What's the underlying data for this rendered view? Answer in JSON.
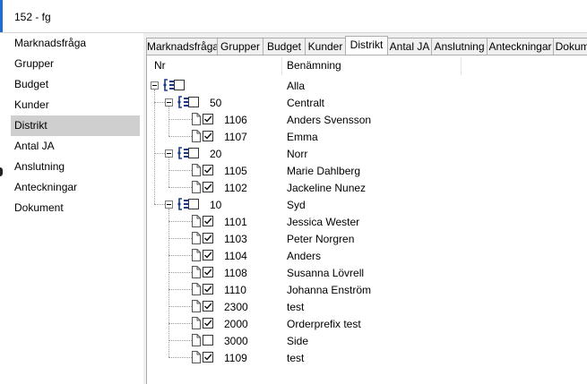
{
  "window": {
    "title": "152 - fg"
  },
  "sidebar": {
    "items": [
      {
        "label": "Marknadsfråga"
      },
      {
        "label": "Grupper"
      },
      {
        "label": "Budget"
      },
      {
        "label": "Kunder"
      },
      {
        "label": "Distrikt"
      },
      {
        "label": "Antal JA"
      },
      {
        "label": "Anslutning"
      },
      {
        "label": "Anteckningar"
      },
      {
        "label": "Dokument"
      }
    ],
    "selected": "Distrikt"
  },
  "tabs": [
    {
      "label": "Marknadsfråga"
    },
    {
      "label": "Grupper"
    },
    {
      "label": "Budget"
    },
    {
      "label": "Kunder"
    },
    {
      "label": "Distrikt",
      "active": true
    },
    {
      "label": "Antal JA"
    },
    {
      "label": "Anslutning"
    },
    {
      "label": "Anteckningar"
    },
    {
      "label": "Dokument"
    }
  ],
  "grid": {
    "columns": {
      "nr": "Nr",
      "name": "Benämning"
    }
  },
  "tree": [
    {
      "level": 0,
      "type": "folder",
      "nr": "",
      "name": "Alla",
      "checked": false
    },
    {
      "level": 1,
      "type": "folder",
      "nr": "50",
      "name": "Centralt",
      "checked": false
    },
    {
      "level": 2,
      "type": "item",
      "nr": "1106",
      "name": "Anders Svensson",
      "checked": true
    },
    {
      "level": 2,
      "type": "item",
      "nr": "1107",
      "name": "Emma",
      "checked": true
    },
    {
      "level": 1,
      "type": "folder",
      "nr": "20",
      "name": "Norr",
      "checked": false
    },
    {
      "level": 2,
      "type": "item",
      "nr": "1105",
      "name": "Marie Dahlberg",
      "checked": true
    },
    {
      "level": 2,
      "type": "item",
      "nr": "1102",
      "name": "Jackeline Nunez",
      "checked": true
    },
    {
      "level": 1,
      "type": "folder",
      "nr": "10",
      "name": "Syd",
      "checked": false
    },
    {
      "level": 2,
      "type": "item",
      "nr": "1101",
      "name": "Jessica Wester",
      "checked": true
    },
    {
      "level": 2,
      "type": "item",
      "nr": "1103",
      "name": "Peter Norgren",
      "checked": true
    },
    {
      "level": 2,
      "type": "item",
      "nr": "1104",
      "name": "Anders",
      "checked": true
    },
    {
      "level": 2,
      "type": "item",
      "nr": "1108",
      "name": "Susanna Lövrell",
      "checked": true
    },
    {
      "level": 2,
      "type": "item",
      "nr": "1110",
      "name": "Johanna Enström",
      "checked": true
    },
    {
      "level": 2,
      "type": "item",
      "nr": "2300",
      "name": "test",
      "checked": true
    },
    {
      "level": 2,
      "type": "item",
      "nr": "2000",
      "name": "Orderprefix test",
      "checked": true
    },
    {
      "level": 2,
      "type": "item",
      "nr": "3000",
      "name": "Side",
      "checked": false
    },
    {
      "level": 2,
      "type": "item",
      "nr": "1109",
      "name": "test",
      "checked": true
    }
  ],
  "icons": {
    "folder": "folder-tree-icon",
    "item": "document-page-icon",
    "expand": "collapse-minus-icon"
  }
}
